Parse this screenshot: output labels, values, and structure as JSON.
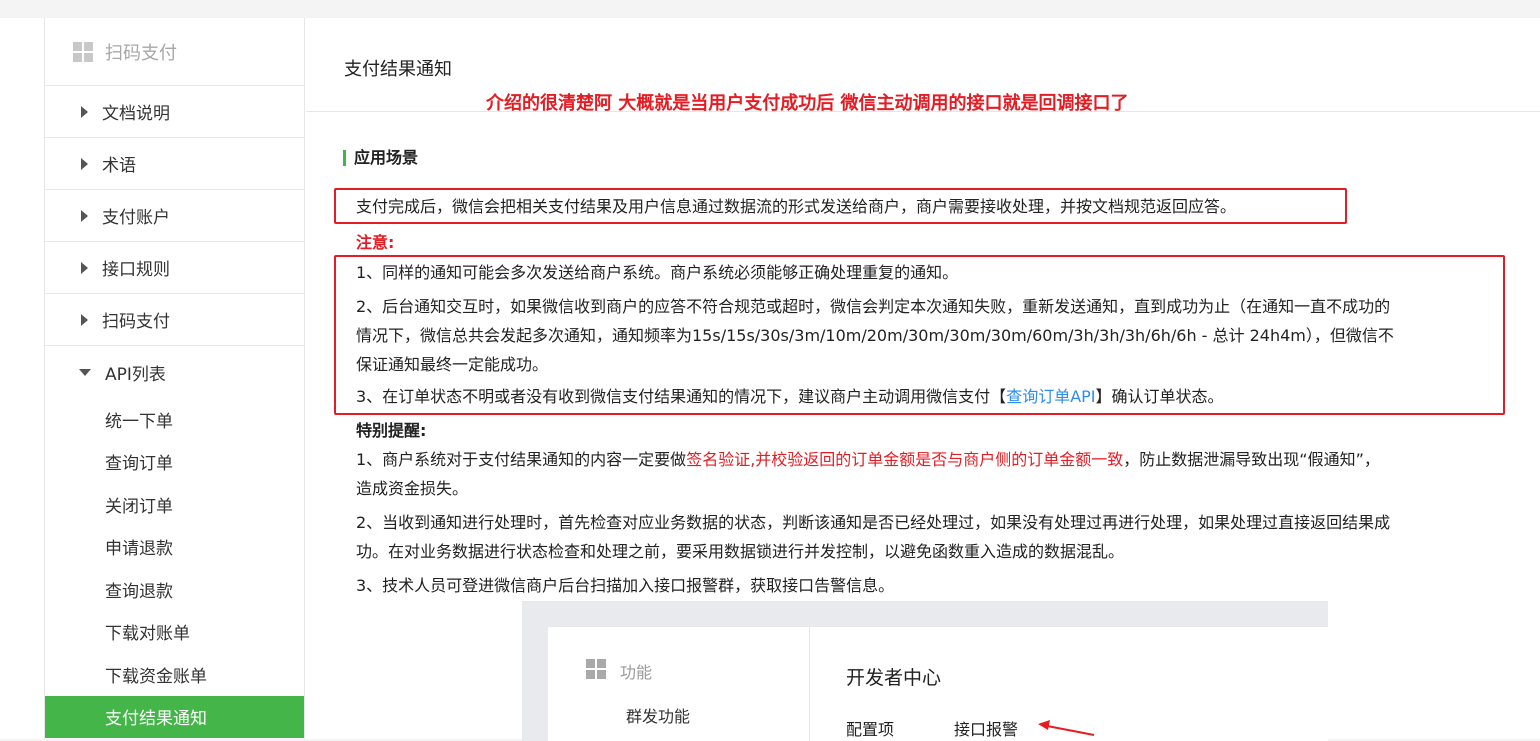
{
  "sidebar": {
    "title": "扫码支付",
    "items": [
      {
        "label": "文档说明"
      },
      {
        "label": "术语"
      },
      {
        "label": "支付账户"
      },
      {
        "label": "接口规则"
      },
      {
        "label": "扫码支付"
      }
    ],
    "api_group": "API列表",
    "sub_items": [
      {
        "label": "统一下单"
      },
      {
        "label": "查询订单"
      },
      {
        "label": "关闭订单"
      },
      {
        "label": "申请退款"
      },
      {
        "label": "查询退款"
      },
      {
        "label": "下载对账单"
      },
      {
        "label": "下载资金账单"
      },
      {
        "label": "支付结果通知"
      }
    ],
    "active_index": 7
  },
  "main": {
    "title": "支付结果通知",
    "annotation": "介绍的很清楚阿  大概就是当用户支付成功后  微信主动调用的接口就是回调接口了",
    "section_title": "应用场景",
    "intro": "支付完成后，微信会把相关支付结果及用户信息通过数据流的形式发送给商户，商户需要接收处理，并按文档规范返回应答。",
    "notice_label": "注意:",
    "notices": [
      "1、同样的通知可能会多次发送给商户系统。商户系统必须能够正确处理重复的通知。",
      "2、后台通知交互时，如果微信收到商户的应答不符合规范或超时，微信会判定本次通知失败，重新发送通知，直到成功为止（在通知一直不成功的",
      "情况下，微信总共会发起多次通知，通知频率为15s/15s/30s/3m/10m/20m/30m/30m/30m/60m/3h/3h/3h/6h/6h - 总计 24h4m），但微信不",
      "保证通知最终一定能成功。"
    ],
    "notice3_prefix": "3、在订单状态不明或者没有收到微信支付结果通知的情况下，建议商户主动调用微信支付【",
    "notice3_link": "查询订单API",
    "notice3_suffix": "】确认订单状态。",
    "remind_label": "特别提醒:",
    "remind1_prefix": "1、商户系统对于支付结果通知的内容一定要做",
    "remind1_red": "签名验证,并校验返回的订单金额是否与商户侧的订单金额一致",
    "remind1_suffix": "，防止数据泄漏导致出现“假通知”，",
    "remind1_line2": "造成资金损失。",
    "remind2_line1": "2、当收到通知进行处理时，首先检查对应业务数据的状态，判断该通知是否已经处理过，如果没有处理过再进行处理，如果处理过直接返回结果成",
    "remind2_line2": "功。在对业务数据进行状态检查和处理之前，要采用数据锁进行并发控制，以避免函数重入造成的数据混乱。",
    "remind3": "3、技术人员可登进微信商户后台扫描加入接口报警群，获取接口告警信息。"
  },
  "screenshot": {
    "func_label": "功能",
    "func_item": "群发功能",
    "dev_center": "开发者中心",
    "config_label": "配置项",
    "alert_label": "接口报警"
  },
  "colors": {
    "accent": "#44b549",
    "annotation_red": "#e51c23",
    "link": "#2d8cf0"
  }
}
